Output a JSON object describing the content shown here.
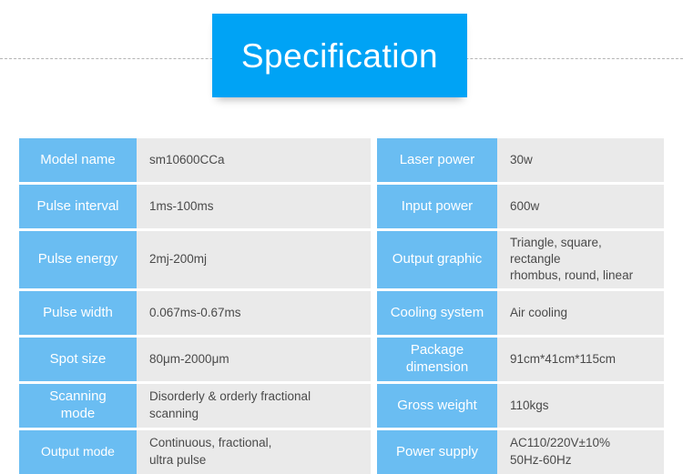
{
  "header": {
    "title": "Specification",
    "box_color": "#00a3f5",
    "title_color": "#ffffff",
    "divider_style": "dashed"
  },
  "theme": {
    "label_cell_color": "#6abdf2",
    "value_cell_color": "#eaeaea",
    "value_text_color": "#4a4a4a",
    "page_background": "#ffffff"
  },
  "spec_table": {
    "rows": [
      {
        "left": {
          "label": "Model name",
          "value": "sm10600CCa"
        },
        "right": {
          "label": "Laser power",
          "value": "30w"
        }
      },
      {
        "left": {
          "label": "Pulse interval",
          "value": "1ms-100ms"
        },
        "right": {
          "label": "Input power",
          "value": "600w"
        }
      },
      {
        "left": {
          "label": "Pulse energy",
          "value": "2mj-200mj"
        },
        "right": {
          "label": "Output graphic",
          "value": "Triangle, square, rectangle\nrhombus, round, linear"
        }
      },
      {
        "left": {
          "label": "Pulse width",
          "value": "0.067ms-0.67ms"
        },
        "right": {
          "label": "Cooling system",
          "value": "Air cooling"
        }
      },
      {
        "left": {
          "label": "Spot size",
          "value": "80μm-2000μm"
        },
        "right": {
          "label": "Package\ndimension",
          "value": "91cm*41cm*115cm"
        }
      },
      {
        "left": {
          "label": "Scanning\nmode",
          "value": "Disorderly & orderly fractional\nscanning"
        },
        "right": {
          "label": "Gross weight",
          "value": "110kgs"
        }
      },
      {
        "left": {
          "label": "Output mode",
          "value": "Continuous, fractional,\nultra pulse"
        },
        "right": {
          "label": "Power supply",
          "value": "AC110/220V±10%\n50Hz-60Hz"
        }
      }
    ]
  }
}
